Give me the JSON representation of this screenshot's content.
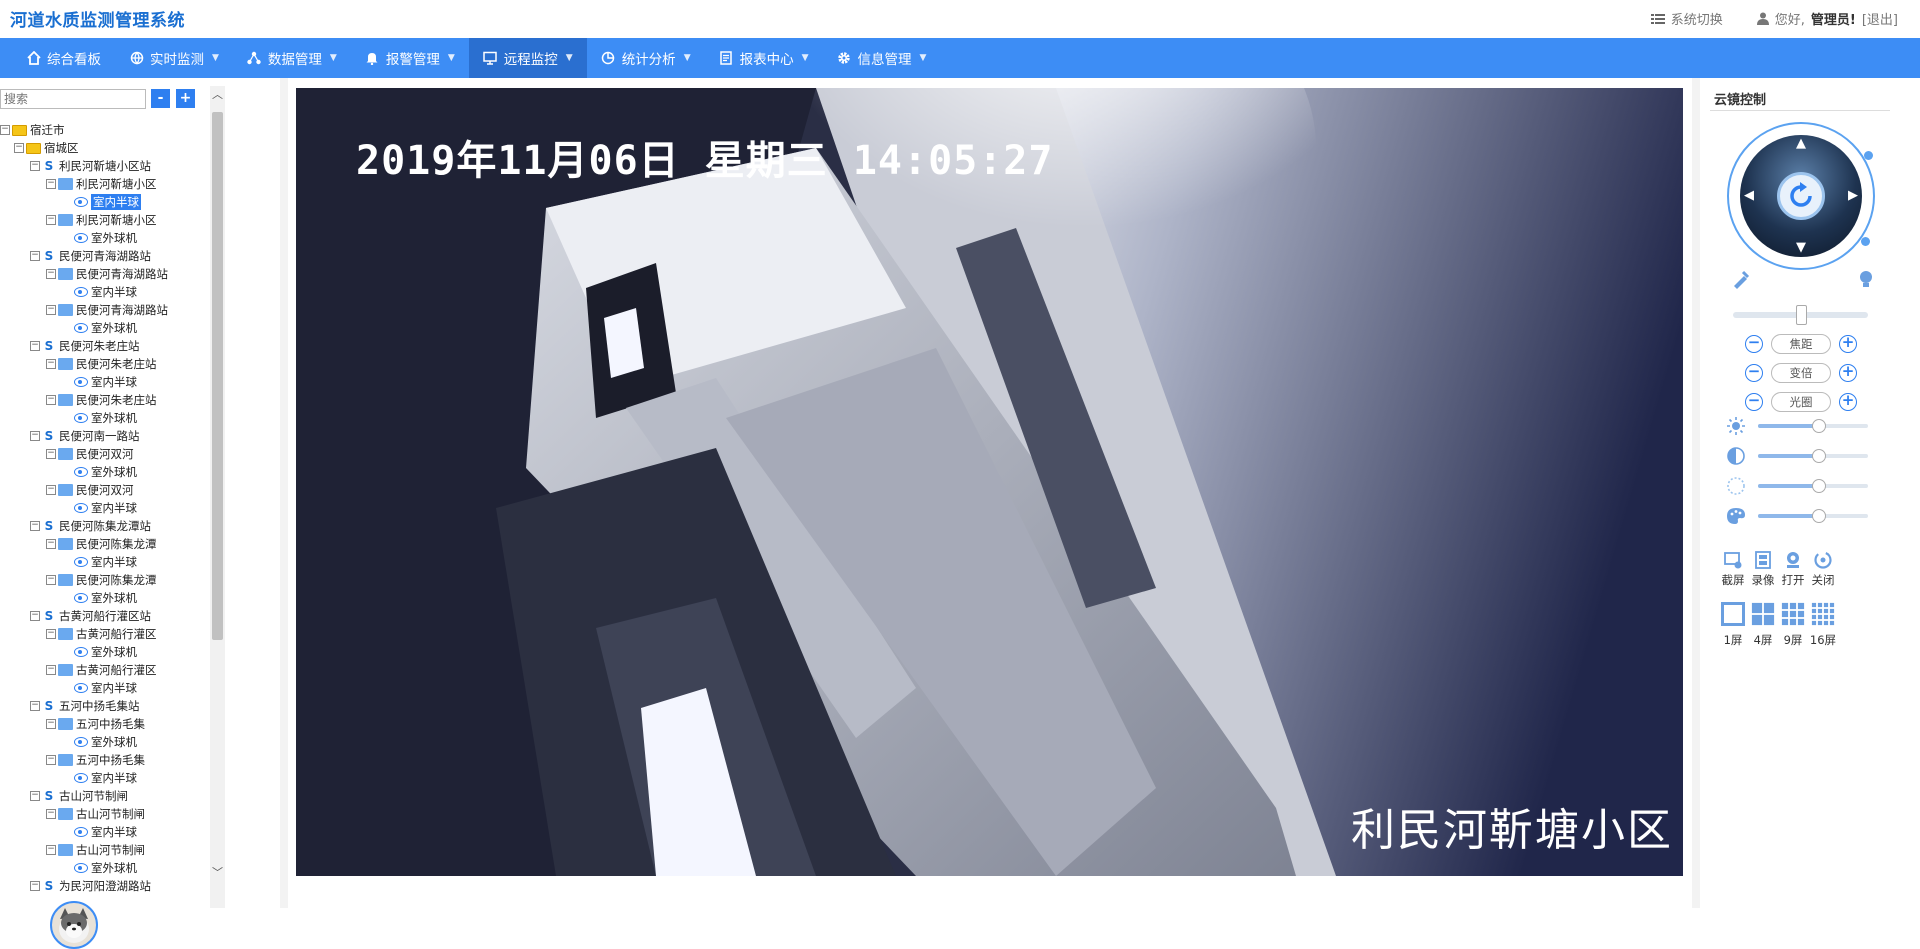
{
  "app": {
    "title": "河道水质监测管理系统"
  },
  "header": {
    "switch_label": "系统切换",
    "greeting": "您好,",
    "user": "管理员!",
    "logout": "[退出]"
  },
  "nav": [
    {
      "label": "综合看板",
      "icon": "home-icon"
    },
    {
      "label": "实时监测",
      "icon": "globe-icon"
    },
    {
      "label": "数据管理",
      "icon": "network-icon"
    },
    {
      "label": "报警管理",
      "icon": "bell-icon"
    },
    {
      "label": "远程监控",
      "icon": "monitor-icon",
      "active": true
    },
    {
      "label": "统计分析",
      "icon": "pie-chart-icon"
    },
    {
      "label": "报表中心",
      "icon": "report-icon"
    },
    {
      "label": "信息管理",
      "icon": "gear-icon"
    }
  ],
  "search": {
    "placeholder": "搜索",
    "minus": "-",
    "plus": "+"
  },
  "tree": [
    {
      "label": "宿迁市",
      "type": "folder",
      "level": 0
    },
    {
      "label": "宿城区",
      "type": "folder",
      "level": 1
    },
    {
      "label": "利民河靳塘小区站",
      "type": "station",
      "level": 2
    },
    {
      "label": "利民河靳塘小区",
      "type": "site",
      "level": 3
    },
    {
      "label": "室内半球",
      "type": "camera",
      "level": 4,
      "selected": true
    },
    {
      "label": "利民河靳塘小区",
      "type": "site",
      "level": 3
    },
    {
      "label": "室外球机",
      "type": "camera",
      "level": 4
    },
    {
      "label": "民便河青海湖路站",
      "type": "station",
      "level": 2
    },
    {
      "label": "民便河青海湖路站",
      "type": "site",
      "level": 3
    },
    {
      "label": "室内半球",
      "type": "camera",
      "level": 4
    },
    {
      "label": "民便河青海湖路站",
      "type": "site",
      "level": 3
    },
    {
      "label": "室外球机",
      "type": "camera",
      "level": 4
    },
    {
      "label": "民便河朱老庄站",
      "type": "station",
      "level": 2
    },
    {
      "label": "民便河朱老庄站",
      "type": "site",
      "level": 3
    },
    {
      "label": "室内半球",
      "type": "camera",
      "level": 4
    },
    {
      "label": "民便河朱老庄站",
      "type": "site",
      "level": 3
    },
    {
      "label": "室外球机",
      "type": "camera",
      "level": 4
    },
    {
      "label": "民便河南一路站",
      "type": "station",
      "level": 2
    },
    {
      "label": "民便河双河",
      "type": "site",
      "level": 3
    },
    {
      "label": "室外球机",
      "type": "camera",
      "level": 4
    },
    {
      "label": "民便河双河",
      "type": "site",
      "level": 3
    },
    {
      "label": "室内半球",
      "type": "camera",
      "level": 4
    },
    {
      "label": "民便河陈集龙潭站",
      "type": "station",
      "level": 2
    },
    {
      "label": "民便河陈集龙潭",
      "type": "site",
      "level": 3
    },
    {
      "label": "室内半球",
      "type": "camera",
      "level": 4
    },
    {
      "label": "民便河陈集龙潭",
      "type": "site",
      "level": 3
    },
    {
      "label": "室外球机",
      "type": "camera",
      "level": 4
    },
    {
      "label": "古黄河船行灌区站",
      "type": "station",
      "level": 2
    },
    {
      "label": "古黄河船行灌区",
      "type": "site",
      "level": 3
    },
    {
      "label": "室外球机",
      "type": "camera",
      "level": 4
    },
    {
      "label": "古黄河船行灌区",
      "type": "site",
      "level": 3
    },
    {
      "label": "室内半球",
      "type": "camera",
      "level": 4
    },
    {
      "label": "五河中扬毛集站",
      "type": "station",
      "level": 2
    },
    {
      "label": "五河中扬毛集",
      "type": "site",
      "level": 3
    },
    {
      "label": "室外球机",
      "type": "camera",
      "level": 4
    },
    {
      "label": "五河中扬毛集",
      "type": "site",
      "level": 3
    },
    {
      "label": "室内半球",
      "type": "camera",
      "level": 4
    },
    {
      "label": "古山河节制闸",
      "type": "station",
      "level": 2
    },
    {
      "label": "古山河节制闸",
      "type": "site",
      "level": 3
    },
    {
      "label": "室内半球",
      "type": "camera",
      "level": 4
    },
    {
      "label": "古山河节制闸",
      "type": "site",
      "level": 3
    },
    {
      "label": "室外球机",
      "type": "camera",
      "level": 4
    },
    {
      "label": "为民河阳澄湖路站",
      "type": "station",
      "level": 2
    }
  ],
  "video": {
    "osd_time": "2019年11月06日  星期三  14:05:27",
    "osd_name": "利民河靳塘小区"
  },
  "ptz": {
    "title": "云镜控制",
    "speed": 0.5,
    "rows": [
      {
        "label": "焦距"
      },
      {
        "label": "变倍"
      },
      {
        "label": "光圈"
      }
    ],
    "adjust": [
      {
        "name": "brightness",
        "icon": "brightness-icon",
        "value": 0.55
      },
      {
        "name": "contrast",
        "icon": "contrast-icon",
        "value": 0.55
      },
      {
        "name": "saturation",
        "icon": "saturation-icon",
        "value": 0.55
      },
      {
        "name": "hue",
        "icon": "palette-icon",
        "value": 0.55
      }
    ],
    "tools": [
      {
        "label": "截屏",
        "icon": "screenshot-icon"
      },
      {
        "label": "录像",
        "icon": "record-icon"
      },
      {
        "label": "打开",
        "icon": "open-icon"
      },
      {
        "label": "关闭",
        "icon": "close-icon"
      }
    ],
    "screens": [
      {
        "label": "1屏"
      },
      {
        "label": "4屏"
      },
      {
        "label": "9屏"
      },
      {
        "label": "16屏"
      }
    ]
  },
  "colors": {
    "primary": "#3d8df5",
    "nav_active": "#2a6fd0",
    "title": "#1a6fd1"
  }
}
